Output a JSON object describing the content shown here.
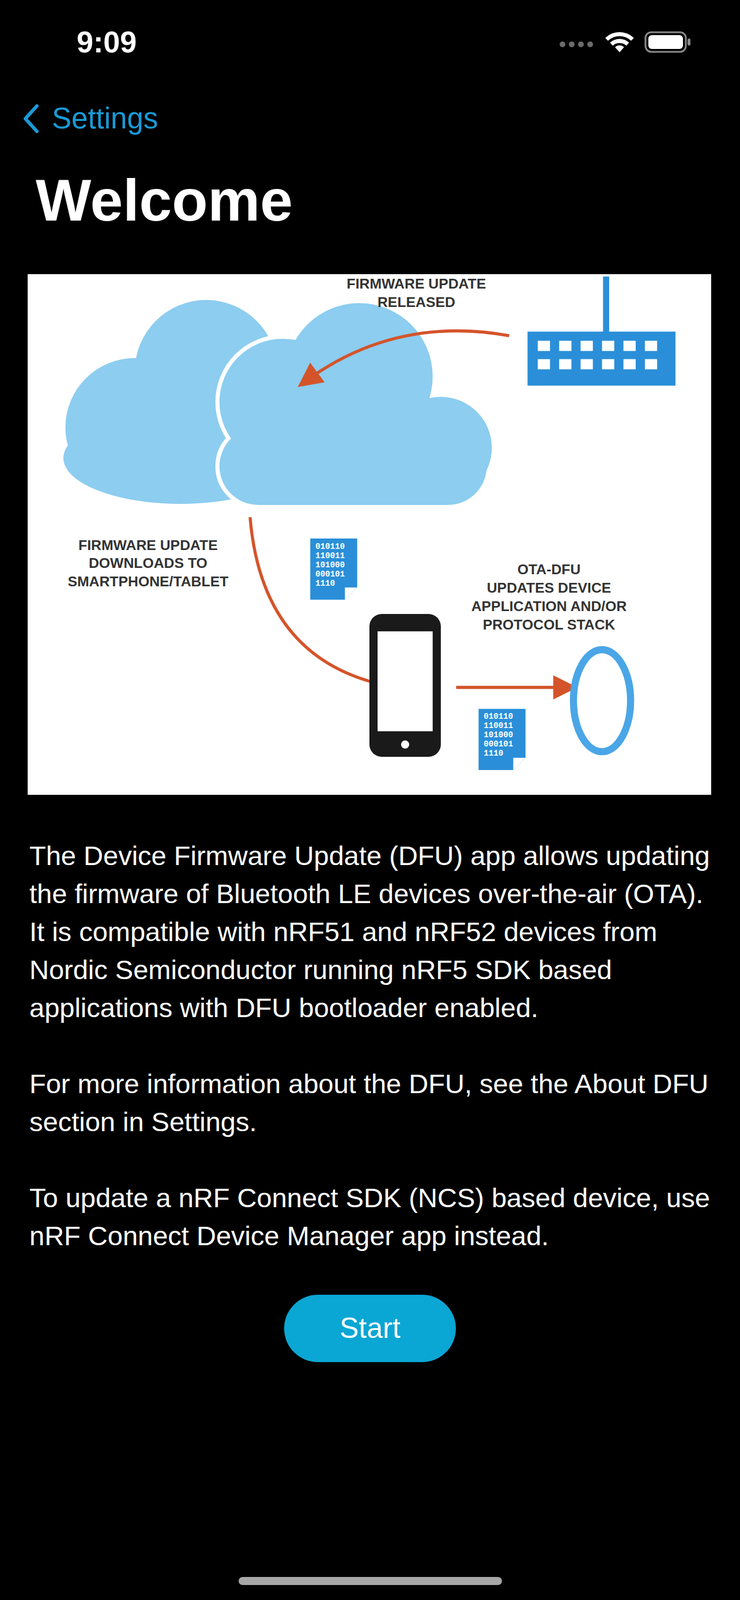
{
  "status_bar": {
    "time": "9:09"
  },
  "nav": {
    "back": "Settings"
  },
  "title": "Welcome",
  "illustration": {
    "released": [
      "FIRMWARE UPDATE",
      "RELEASED"
    ],
    "download": [
      "FIRMWARE UPDATE",
      "DOWNLOADS TO",
      "SMARTPHONE/TABLET"
    ],
    "ota": [
      "OTA-DFU",
      "UPDATES DEVICE",
      "APPLICATION AND/OR",
      "PROTOCOL STACK"
    ],
    "file_lines": [
      "010110",
      "110011",
      "101000",
      "000101",
      "1110"
    ]
  },
  "paragraphs": [
    "The Device Firmware Update (DFU) app allows updating the firmware of Bluetooth LE devices over-the-air (OTA). It is compatible with nRF51 and nRF52 devices from Nordic Semiconductor running nRF5 SDK based applications with DFU bootloader enabled.",
    "For more information about the DFU, see the About DFU section in Settings.",
    "To update a nRF Connect SDK (NCS) based device, use nRF Connect Device Manager app instead."
  ],
  "button": "Start"
}
